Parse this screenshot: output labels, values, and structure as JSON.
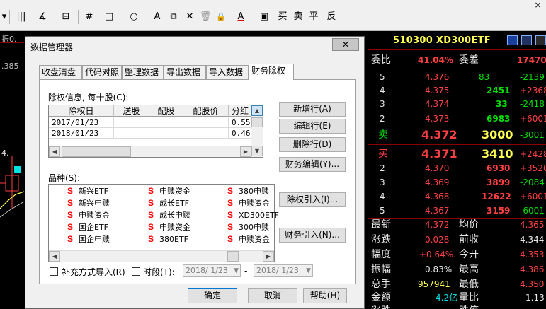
{
  "toolbar": {
    "items": [
      {
        "label": "▾",
        "name": "dropdown-arrow"
      },
      {
        "label": "|||",
        "name": "bar-chart-icon"
      },
      {
        "label": "∡",
        "name": "angle-icon"
      },
      {
        "label": "⊟",
        "name": "list-icon"
      },
      {
        "label": "#",
        "name": "grid-icon"
      },
      {
        "label": "□",
        "name": "rectangle-icon"
      },
      {
        "label": "○",
        "name": "circle-icon"
      },
      {
        "label": "A",
        "name": "text-icon"
      },
      {
        "label": "⧉",
        "name": "copy-icon"
      },
      {
        "label": "✕",
        "name": "delete-icon"
      },
      {
        "label": "🗑",
        "name": "trash-icon"
      },
      {
        "label": "🔒",
        "name": "lock-icon"
      },
      {
        "label": "A",
        "name": "font-color-icon"
      },
      {
        "label": "▣",
        "name": "save-icon"
      },
      {
        "label": "买",
        "name": "buy-button"
      },
      {
        "label": "卖",
        "name": "sell-button"
      },
      {
        "label": "平",
        "name": "close-position-button"
      },
      {
        "label": "反",
        "name": "reverse-button"
      }
    ],
    "close": "×"
  },
  "left_panel": {
    "labels": [
      "振0.",
      ".385",
      "4."
    ]
  },
  "dialog": {
    "title": "数据管理器",
    "close": "✕",
    "tabs": [
      "收盘清盘",
      "代码对照",
      "整理数据",
      "导出数据",
      "导入数据",
      "财务除权"
    ],
    "active_tab": 5,
    "exright_label": "除权信息, 每十股(C):",
    "grid": {
      "columns": [
        "除权日",
        "送股",
        "配股",
        "配股价",
        "分红"
      ],
      "rows": [
        [
          "2017/01/23",
          "",
          "",
          "",
          "0.55"
        ],
        [
          "2018/01/23",
          "",
          "",
          "",
          "0.46"
        ]
      ]
    },
    "buttons_right": [
      "新增行(A)",
      "编辑行(E)",
      "删除行(D)",
      "财务编辑(Y)...",
      "除权引入(I)...",
      "财务引入(N)..."
    ],
    "variety_label": "品种(S):",
    "varieties": [
      [
        "新兴ETF",
        "新兴申赎",
        "申赎资金",
        "国企ETF",
        "国企申赎"
      ],
      [
        "申赎资金",
        "成长ETF",
        "成长申赎",
        "申赎资金",
        "380ETF"
      ],
      [
        "380申赎",
        "申赎资金",
        "XD300ETF",
        "300申赎",
        "申赎资金"
      ]
    ],
    "variety_prefix": "S",
    "supplement_label": "补充方式导入(R)",
    "period_label": "时段(T):",
    "date_from": "2018/ 1/23",
    "date_to": "2018/ 1/23",
    "dash": "-",
    "ok": "确定",
    "cancel": "取消",
    "help": "帮助(H)"
  },
  "quote": {
    "symbol": "510300 XD300ETF",
    "ratio_label": "委比",
    "ratio_value": "41.04%",
    "diff_label": "委差",
    "diff_value": "17470",
    "asks": [
      {
        "level": "5",
        "price": "4.376",
        "vol": "83",
        "chg": "-2139"
      },
      {
        "level": "4",
        "price": "4.375",
        "vol": "2451",
        "chg": "+2368"
      },
      {
        "level": "3",
        "price": "4.374",
        "vol": "33",
        "chg": "-2418"
      },
      {
        "level": "2",
        "price": "4.373",
        "vol": "6983",
        "chg": "+6001"
      },
      {
        "level": "卖",
        "price": "4.372",
        "vol": "3000",
        "chg": "-3001"
      }
    ],
    "bids": [
      {
        "level": "买",
        "price": "4.371",
        "vol": "3410",
        "chg": "+2428"
      },
      {
        "level": "2",
        "price": "4.370",
        "vol": "6930",
        "chg": "+3520"
      },
      {
        "level": "3",
        "price": "4.369",
        "vol": "3899",
        "chg": "-2084"
      },
      {
        "level": "4",
        "price": "4.368",
        "vol": "12622",
        "chg": "+6001"
      },
      {
        "level": "5",
        "price": "4.367",
        "vol": "3159",
        "chg": "-6001"
      }
    ],
    "stats": [
      {
        "l1": "最新",
        "v1": "4.372",
        "l2": "均价",
        "v2": "4.365"
      },
      {
        "l1": "涨跌",
        "v1": "0.028",
        "l2": "前收",
        "v2": "4.344"
      },
      {
        "l1": "幅度",
        "v1": "+0.64%",
        "l2": "今开",
        "v2": "4.353"
      },
      {
        "l1": "振幅",
        "v1": "0.83%",
        "l2": "最高",
        "v2": "4.386"
      },
      {
        "l1": "总手",
        "v1": "957941",
        "l2": "最低",
        "v2": "4.350"
      },
      {
        "l1": "金额",
        "v1": "4.2亿",
        "l2": "量比",
        "v2": "1.13"
      },
      {
        "l1": "涨跌",
        "v1": "",
        "l2": "跌停",
        "v2": ""
      }
    ],
    "colors": {
      "red": "#ff4040",
      "green": "#00e000",
      "yellow": "#ffff54"
    }
  }
}
